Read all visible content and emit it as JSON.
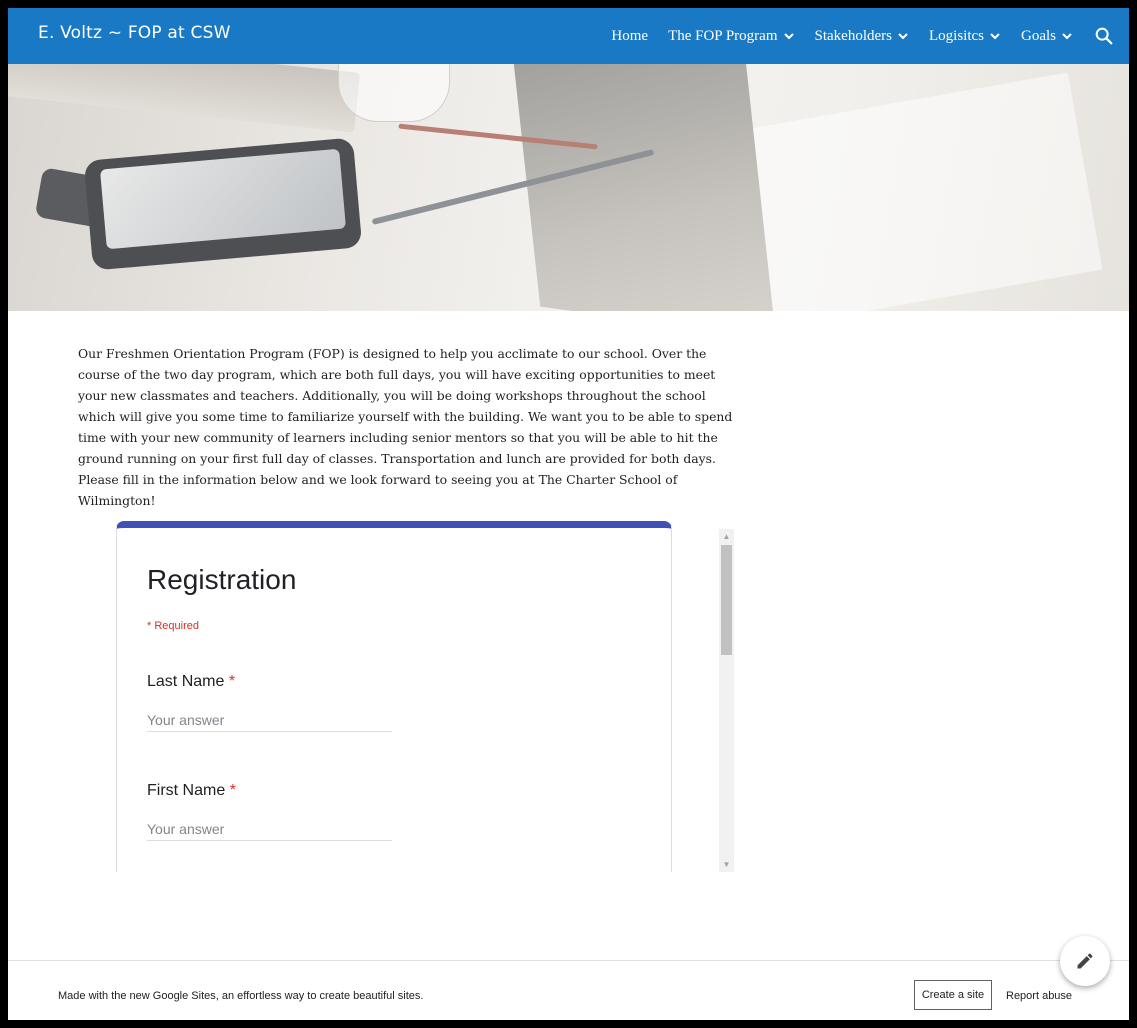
{
  "header": {
    "site_title": "E. Voltz ~ FOP at CSW",
    "nav": [
      {
        "label": "Home",
        "has_dropdown": false
      },
      {
        "label": "The FOP Program",
        "has_dropdown": true
      },
      {
        "label": "Stakeholders",
        "has_dropdown": true
      },
      {
        "label": "Logisitcs",
        "has_dropdown": true
      },
      {
        "label": "Goals",
        "has_dropdown": true
      }
    ],
    "search_icon": "search-icon",
    "bar_color": "#1a79c5"
  },
  "main": {
    "intro": "Our Freshmen Orientation Program (FOP) is designed to help you acclimate to our school. Over the course of the two day program, which are both full days, you will have exciting opportunities to meet your new classmates and teachers. Additionally, you will be doing workshops throughout the school which will give you some time to familiarize yourself with the building. We want you to be able to spend time with your new community of learners including senior mentors so that you will be able to hit the ground running on your first full day of classes.  Transportation and lunch are provided for both days. Please fill in the information below and we look forward to seeing you at The Charter School of Wilmington!"
  },
  "form": {
    "title": "Registration",
    "required_note": "* Required",
    "accent_color": "#3f51b5",
    "questions": [
      {
        "label": "Last Name",
        "required_mark": "*",
        "placeholder": "Your answer"
      },
      {
        "label": "First Name",
        "required_mark": "*",
        "placeholder": "Your answer"
      }
    ]
  },
  "footer": {
    "made_with": "Made with the new Google Sites, an effortless way to create beautiful sites.",
    "create_site": "Create a site",
    "report_abuse": "Report abuse",
    "edit_icon": "pencil-icon"
  }
}
